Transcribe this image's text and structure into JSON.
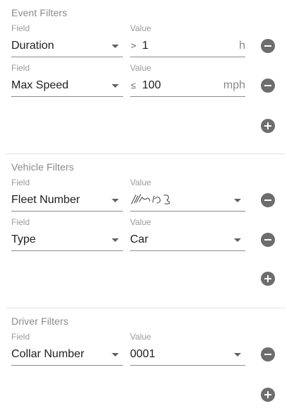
{
  "event_filters": {
    "title": "Event Filters",
    "rows": [
      {
        "field_label": "Field",
        "field_value": "Duration",
        "value_label": "Value",
        "operator": ">",
        "value": "1",
        "unit": "h"
      },
      {
        "field_label": "Field",
        "field_value": "Max Speed",
        "value_label": "Value",
        "operator": "≤",
        "value": "100",
        "unit": "mph"
      }
    ]
  },
  "vehicle_filters": {
    "title": "Vehicle Filters",
    "rows": [
      {
        "field_label": "Field",
        "field_value": "Fleet Number",
        "value_label": "Value",
        "value_state": "redacted"
      },
      {
        "field_label": "Field",
        "field_value": "Type",
        "value_label": "Value",
        "value": "Car"
      }
    ]
  },
  "driver_filters": {
    "title": "Driver Filters",
    "rows": [
      {
        "field_label": "Field",
        "field_value": "Collar Number",
        "value_label": "Value",
        "value": "0001"
      }
    ]
  },
  "icons": {
    "remove": "remove-circle-icon",
    "add": "add-circle-icon",
    "dropdown": "caret-down-icon"
  },
  "colors": {
    "icon": "#6d6d6d",
    "label": "#9a9a9a",
    "section_title": "#8a8a8a",
    "divider": "#e3e3e3"
  }
}
